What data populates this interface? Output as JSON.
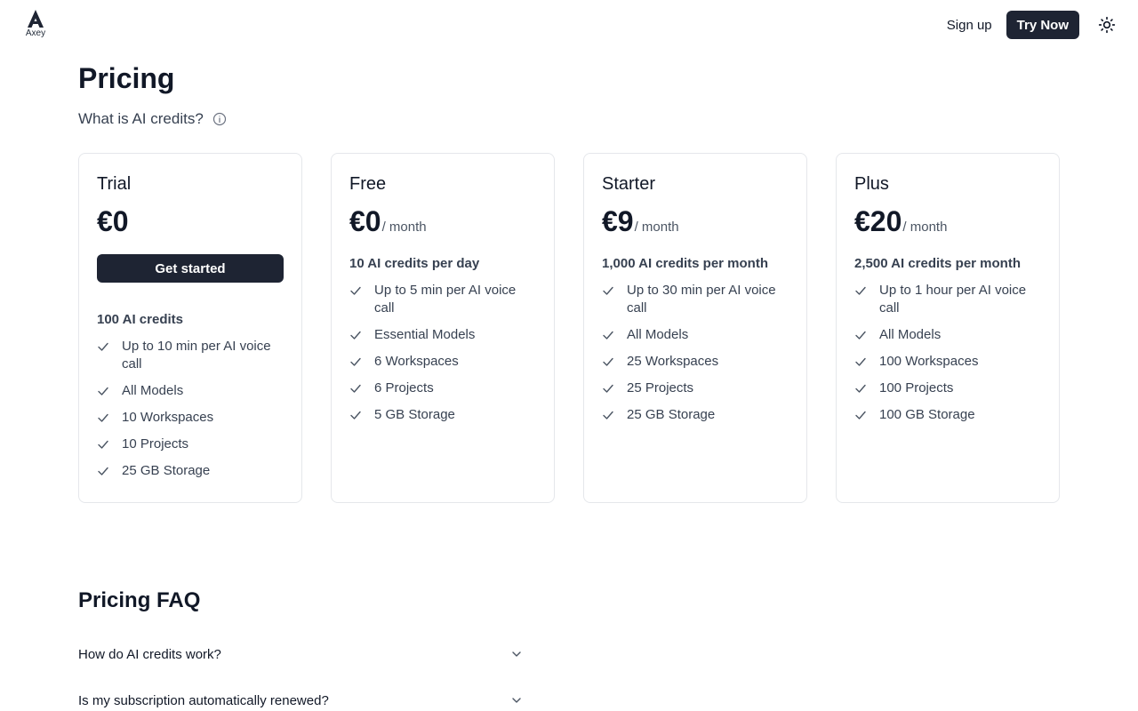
{
  "brand": {
    "name": "Axey"
  },
  "nav": {
    "signup_label": "Sign up",
    "try_label": "Try Now",
    "theme_icon": "sun-icon"
  },
  "page": {
    "title": "Pricing",
    "credits_question": "What is AI credits?"
  },
  "plans": [
    {
      "name": "Trial",
      "price": "€0",
      "period": "",
      "cta": "Get started",
      "credits": "100 AI credits",
      "features": [
        "Up to 10 min per AI voice call",
        "All Models",
        "10 Workspaces",
        "10 Projects",
        "25 GB Storage"
      ]
    },
    {
      "name": "Free",
      "price": "€0",
      "period": "/ month",
      "credits": "10 AI credits per day",
      "features": [
        "Up to 5 min per AI voice call",
        "Essential Models",
        "6 Workspaces",
        "6 Projects",
        "5 GB Storage"
      ]
    },
    {
      "name": "Starter",
      "price": "€9",
      "period": "/ month",
      "credits": "1,000 AI credits per month",
      "features": [
        "Up to 30 min per AI voice call",
        "All Models",
        "25 Workspaces",
        "25 Projects",
        "25 GB Storage"
      ]
    },
    {
      "name": "Plus",
      "price": "€20",
      "period": "/ month",
      "credits": "2,500 AI credits per month",
      "features": [
        "Up to 1 hour per AI voice call",
        "All Models",
        "100 Workspaces",
        "100 Projects",
        "100 GB Storage"
      ]
    }
  ],
  "faq": {
    "title": "Pricing FAQ",
    "items": [
      {
        "question": "How do AI credits work?"
      },
      {
        "question": "Is my subscription automatically renewed?"
      }
    ]
  },
  "colors": {
    "primary_button": "#1e2433",
    "card_border": "#e5e7eb",
    "text": "#111827",
    "muted_text": "#374151"
  }
}
